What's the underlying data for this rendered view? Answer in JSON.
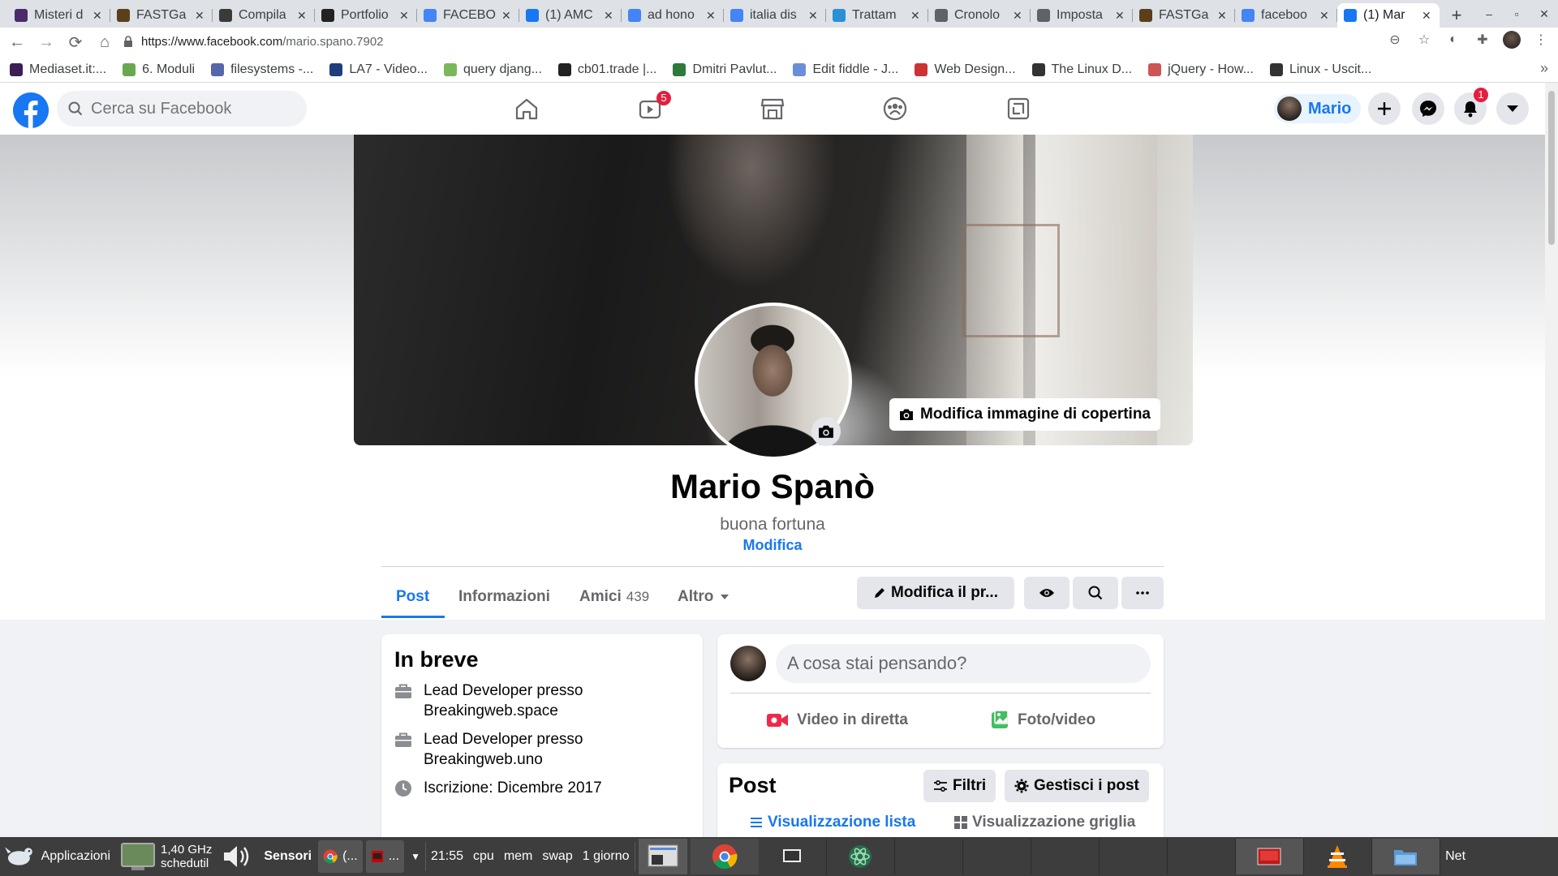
{
  "browser": {
    "tabs": [
      {
        "title": "Misteri d",
        "fav_color": "#4b2a6b",
        "active": false
      },
      {
        "title": "FASTGa",
        "fav_color": "#5a3f1a",
        "active": false
      },
      {
        "title": "Compila",
        "fav_color": "#3a3a3a",
        "active": false
      },
      {
        "title": "Portfolio",
        "fav_color": "#222222",
        "active": false
      },
      {
        "title": "FACEBO",
        "fav_color": "#4285f4",
        "active": false
      },
      {
        "title": "(1) AMC",
        "fav_color": "#1877f2",
        "active": false
      },
      {
        "title": "ad hono",
        "fav_color": "#4285f4",
        "active": false
      },
      {
        "title": "italia dis",
        "fav_color": "#4285f4",
        "active": false
      },
      {
        "title": "Trattam",
        "fav_color": "#2a8fd9",
        "active": false
      },
      {
        "title": "Cronolo",
        "fav_color": "#5f6368",
        "active": false
      },
      {
        "title": "Imposta",
        "fav_color": "#5f6368",
        "active": false
      },
      {
        "title": "FASTGa",
        "fav_color": "#5a3f1a",
        "active": false
      },
      {
        "title": "faceboo",
        "fav_color": "#4285f4",
        "active": false
      },
      {
        "title": "(1) Mar",
        "fav_color": "#1877f2",
        "active": true
      }
    ],
    "url_host": "https://www.facebook.com",
    "url_path": "/mario.spano.7902",
    "bookmarks": [
      {
        "label": "Mediaset.it:...",
        "color": "#3a1f57"
      },
      {
        "label": "6. Moduli",
        "color": "#6aa84f"
      },
      {
        "label": "filesystems -...",
        "color": "#5566aa"
      },
      {
        "label": "LA7 - Video...",
        "color": "#1d3e7a"
      },
      {
        "label": "query djang...",
        "color": "#7ab85a"
      },
      {
        "label": "cb01.trade |...",
        "color": "#222222"
      },
      {
        "label": "Dmitri Pavlut...",
        "color": "#2d7a3a"
      },
      {
        "label": "Edit fiddle - J...",
        "color": "#6b8fd6"
      },
      {
        "label": "Web Design...",
        "color": "#cc3333"
      },
      {
        "label": "The Linux D...",
        "color": "#333333"
      },
      {
        "label": "jQuery - How...",
        "color": "#cc5555"
      },
      {
        "label": "Linux - Uscit...",
        "color": "#333333"
      }
    ]
  },
  "fb": {
    "search_placeholder": "Cerca su Facebook",
    "watch_badge": "5",
    "notif_badge": "1",
    "user_chip": "Mario",
    "cover_button": "Modifica immagine di copertina",
    "profile_name": "Mario Spanò",
    "bio": "buona fortuna",
    "bio_edit": "Modifica",
    "tabs": {
      "post": "Post",
      "info": "Informazioni",
      "friends": "Amici",
      "friends_count": "439",
      "more": "Altro"
    },
    "edit_profile": "Modifica il pr...",
    "intro": {
      "title": "In breve",
      "items": [
        "Lead Developer presso Breakingweb.space",
        "Lead Developer presso Breakingweb.uno",
        "Iscrizione: Dicembre 2017"
      ]
    },
    "composer": {
      "placeholder": "A cosa stai pensando?",
      "live": "Video in diretta",
      "photo": "Foto/video"
    },
    "posts": {
      "title": "Post",
      "filters": "Filtri",
      "manage": "Gestisci i post",
      "list_view": "Visualizzazione lista",
      "grid_view": "Visualizzazione griglia"
    }
  },
  "taskbar": {
    "apps": "Applicazioni",
    "cpu_freq": "1,40 GHz",
    "governor": "schedutil",
    "sensors": "Sensori",
    "chrome_item": "(...",
    "term_item": "...",
    "clock": "21:55",
    "cpu": "cpu",
    "mem": "mem",
    "swap": "swap",
    "uptime": "1 giorno",
    "net": "Net"
  }
}
